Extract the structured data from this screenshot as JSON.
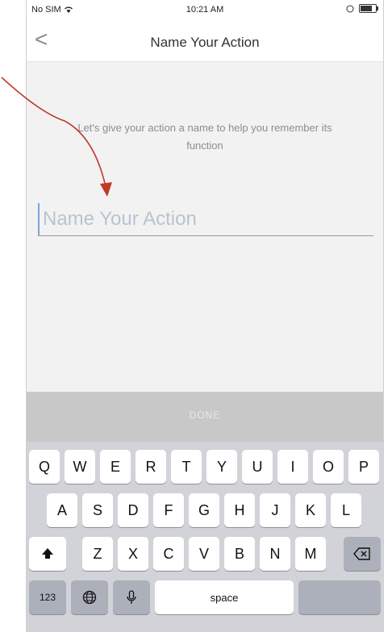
{
  "status_bar": {
    "carrier": "No SIM",
    "time": "10:21 AM"
  },
  "nav": {
    "back_glyph": "<",
    "title": "Name Your Action"
  },
  "instruction": "Let's give your action a name to help you remember its function",
  "name_field": {
    "placeholder": "Name Your Action",
    "value": ""
  },
  "accessory": {
    "done_label": "DONE"
  },
  "keyboard": {
    "row1": [
      "Q",
      "W",
      "E",
      "R",
      "T",
      "Y",
      "U",
      "I",
      "O",
      "P"
    ],
    "row2": [
      "A",
      "S",
      "D",
      "F",
      "G",
      "H",
      "J",
      "K",
      "L"
    ],
    "row3": [
      "Z",
      "X",
      "C",
      "V",
      "B",
      "N",
      "M"
    ],
    "numbers_label": "123",
    "space_label": "space"
  },
  "colors": {
    "annotation_arrow": "#c0392b",
    "keyboard_bg": "#d1d3d9",
    "accessory_bg": "#c8c8c8"
  },
  "icons": [
    "wifi-icon",
    "battery-icon",
    "back-icon",
    "shift-icon",
    "delete-icon",
    "globe-icon",
    "microphone-icon"
  ]
}
